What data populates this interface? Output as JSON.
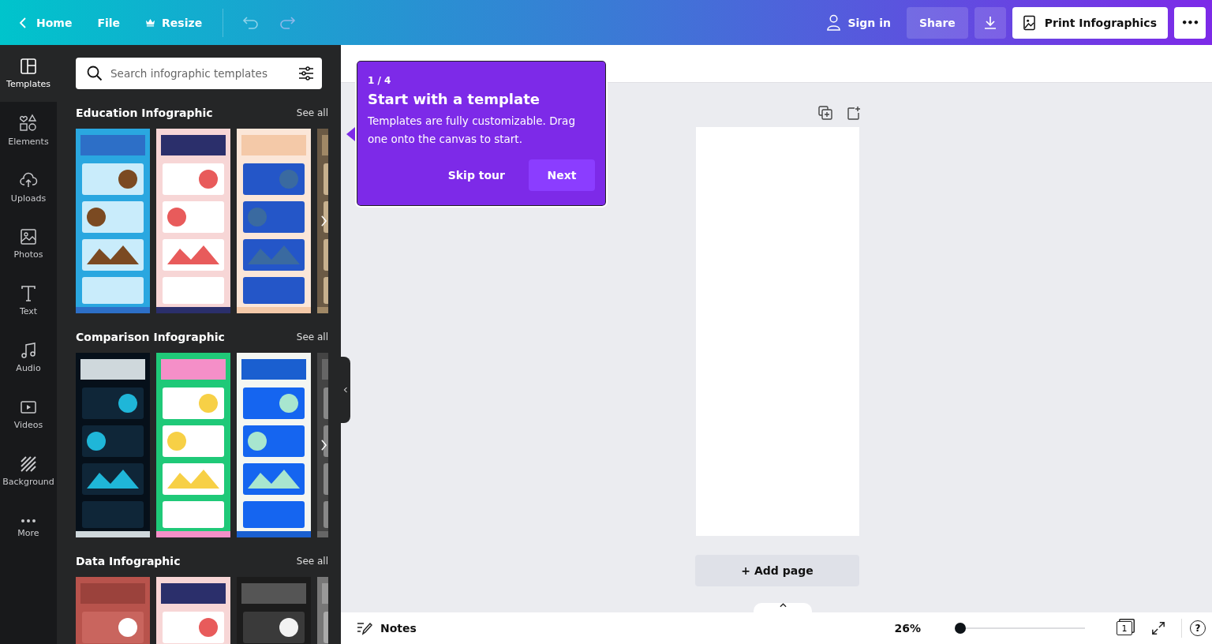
{
  "topbar": {
    "home": "Home",
    "file": "File",
    "resize": "Resize",
    "sign_in": "Sign in",
    "share": "Share",
    "print": "Print Infographics",
    "more": "•••"
  },
  "rail": [
    {
      "label": "Templates",
      "selected": true
    },
    {
      "label": "Elements",
      "selected": false
    },
    {
      "label": "Uploads",
      "selected": false
    },
    {
      "label": "Photos",
      "selected": false
    },
    {
      "label": "Text",
      "selected": false
    },
    {
      "label": "Audio",
      "selected": false
    },
    {
      "label": "Videos",
      "selected": false
    },
    {
      "label": "Background",
      "selected": false
    },
    {
      "label": "More",
      "selected": false
    }
  ],
  "search": {
    "placeholder": "Search infographic templates"
  },
  "sections": [
    {
      "title": "Education Infographic",
      "see_all": "See all"
    },
    {
      "title": "Comparison Infographic",
      "see_all": "See all"
    },
    {
      "title": "Data Infographic",
      "see_all": "See all"
    }
  ],
  "tour": {
    "step": "1 / 4",
    "title": "Start with a template",
    "text": "Templates are fully customizable. Drag one onto the canvas to start.",
    "skip": "Skip tour",
    "next": "Next"
  },
  "add_page": "+ Add page",
  "bottom": {
    "notes": "Notes",
    "zoom": "26%",
    "level": 0,
    "page_count": "1",
    "help": "?"
  }
}
